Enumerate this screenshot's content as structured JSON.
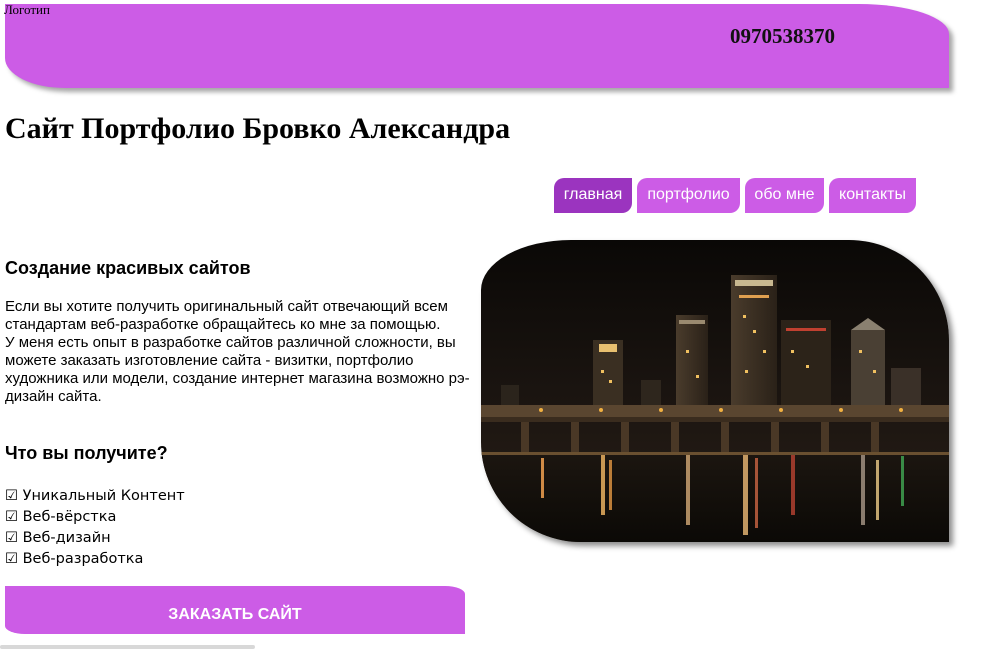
{
  "header": {
    "logo": "Логотип",
    "phone": "0970538370"
  },
  "site_title": "Сайт Портфолио Бровко Александра",
  "nav": {
    "items": [
      {
        "label": "главная",
        "active": true
      },
      {
        "label": "портфолио",
        "active": false
      },
      {
        "label": "обо мне",
        "active": false
      },
      {
        "label": "контакты",
        "active": false
      }
    ]
  },
  "main": {
    "heading": "Создание красивых сайтов",
    "paragraph_1": "Если вы хотите получить оригинальный сайт отвечающий всем стандартам веб-разработке обращайтесь ко мне за помощью.",
    "paragraph_2": "У меня есть опыт в разработке сайтов различной сложности, вы можете заказать изготовление сайта - визитки, портфолио художника или модели, создание интернет магазина возможно рэ-дизайн сайта.",
    "subheading": "Что вы получите?",
    "benefits": [
      "☑ Уникальный Контент",
      "☑ Веб-вёрстка",
      "☑ Веб-дизайн",
      "☑ Веб-разработка"
    ],
    "order_button": "ЗАКАЗАТЬ САЙТ"
  },
  "colors": {
    "accent": "#cc5ce6",
    "accent_active": "#9b34bf"
  }
}
